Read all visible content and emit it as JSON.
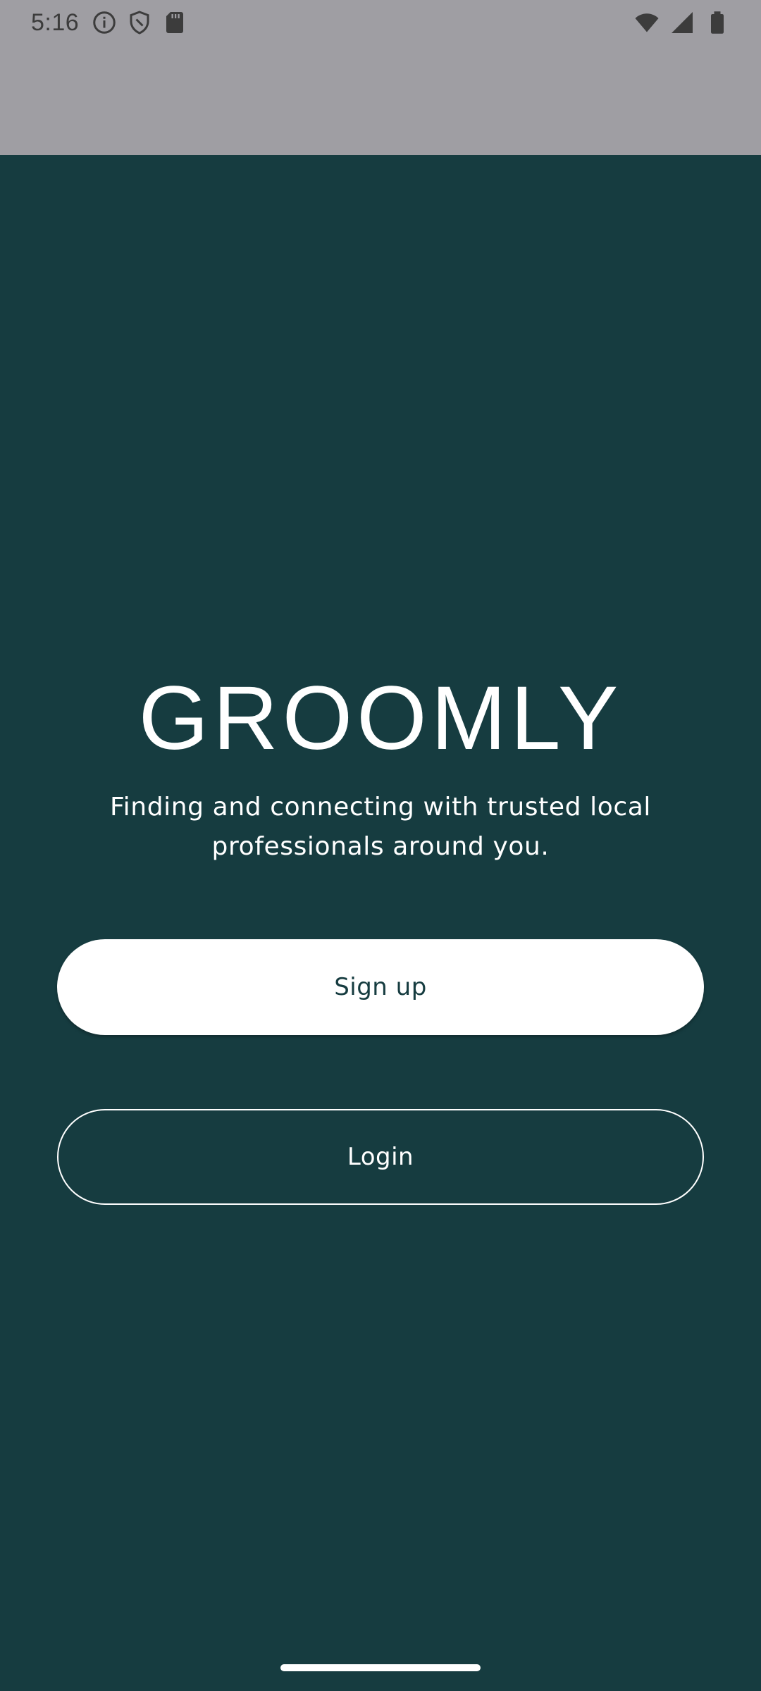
{
  "status_bar": {
    "time": "5:16",
    "left_icons": [
      "info-icon",
      "shield-icon",
      "sd-card-icon"
    ],
    "right_icons": [
      "wifi-icon",
      "signal-icon",
      "battery-icon"
    ],
    "background_color": "#9f9ea3"
  },
  "app": {
    "title": "GROOMLY",
    "tagline": "Finding and connecting with trusted local professionals around you.",
    "background_color": "#163c40"
  },
  "actions": {
    "signup_label": "Sign up",
    "login_label": "Login"
  },
  "colors": {
    "primary": "#163c40",
    "on_primary": "#ffffff"
  }
}
